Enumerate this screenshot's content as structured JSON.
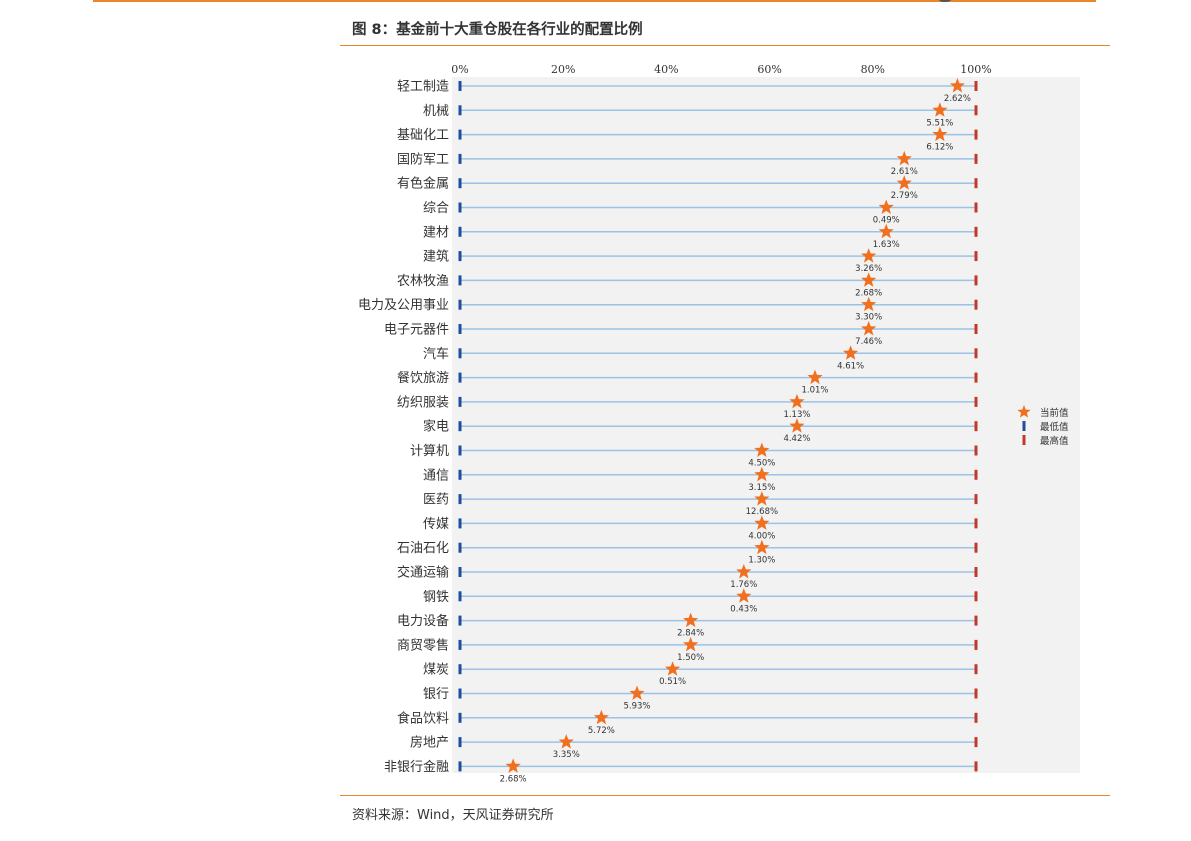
{
  "figure": {
    "title": "图 8：基金前十大重仓股在各行业的配置比例",
    "source": "资料来源：Wind，天风证券研究所"
  },
  "colors": {
    "accent": "#e8862a",
    "current": "#f07020",
    "min": "#1f4e9c",
    "max": "#c0392b",
    "row_line": "#9cc3e4",
    "plot_bg": "#f2f2f2"
  },
  "chart_data": {
    "type": "scatter",
    "title": "",
    "xlabel": "",
    "ylabel": "",
    "xlim": [
      0,
      100
    ],
    "x_ticks": [
      "0%",
      "20%",
      "40%",
      "60%",
      "80%",
      "100%"
    ],
    "grid": false,
    "legend_position": "right",
    "legend": [
      {
        "label": "当前值",
        "marker": "star"
      },
      {
        "label": "最低值",
        "marker": "bar"
      },
      {
        "label": "最高值",
        "marker": "bar"
      }
    ],
    "categories": [
      "轻工制造",
      "机械",
      "基础化工",
      "国防军工",
      "有色金属",
      "综合",
      "建材",
      "建筑",
      "农林牧渔",
      "电力及公用事业",
      "电子元器件",
      "汽车",
      "餐饮旅游",
      "纺织服装",
      "家电",
      "计算机",
      "通信",
      "医药",
      "传媒",
      "石油石化",
      "交通运输",
      "钢铁",
      "电力设备",
      "商贸零售",
      "煤炭",
      "银行",
      "食品饮料",
      "房地产",
      "非银行金融"
    ],
    "series": [
      {
        "name": "当前值",
        "values": [
          96.4,
          93.0,
          93.0,
          86.1,
          86.1,
          82.6,
          82.6,
          79.2,
          79.2,
          79.2,
          79.2,
          75.7,
          68.8,
          65.3,
          65.3,
          58.5,
          58.5,
          58.5,
          58.5,
          58.5,
          55.0,
          55.0,
          44.7,
          44.7,
          41.2,
          34.3,
          27.4,
          20.6,
          10.3
        ]
      },
      {
        "name": "最低值",
        "values": [
          0,
          0,
          0,
          0,
          0,
          0,
          0,
          0,
          0,
          0,
          0,
          0,
          0,
          0,
          0,
          0,
          0,
          0,
          0,
          0,
          0,
          0,
          0,
          0,
          0,
          0,
          0,
          0,
          0
        ]
      },
      {
        "name": "最高值",
        "values": [
          100,
          100,
          100,
          100,
          100,
          100,
          100,
          100,
          100,
          100,
          100,
          100,
          100,
          100,
          100,
          100,
          100,
          100,
          100,
          100,
          100,
          100,
          100,
          100,
          100,
          100,
          100,
          100,
          100
        ]
      }
    ],
    "data_labels": [
      "2.62%",
      "5.51%",
      "6.12%",
      "2.61%",
      "2.79%",
      "0.49%",
      "1.63%",
      "3.26%",
      "2.68%",
      "3.30%",
      "7.46%",
      "4.61%",
      "1.01%",
      "1.13%",
      "4.42%",
      "4.50%",
      "3.15%",
      "12.68%",
      "4.00%",
      "1.30%",
      "1.76%",
      "0.43%",
      "2.84%",
      "1.50%",
      "0.51%",
      "5.93%",
      "5.72%",
      "3.35%",
      "2.68%"
    ]
  }
}
